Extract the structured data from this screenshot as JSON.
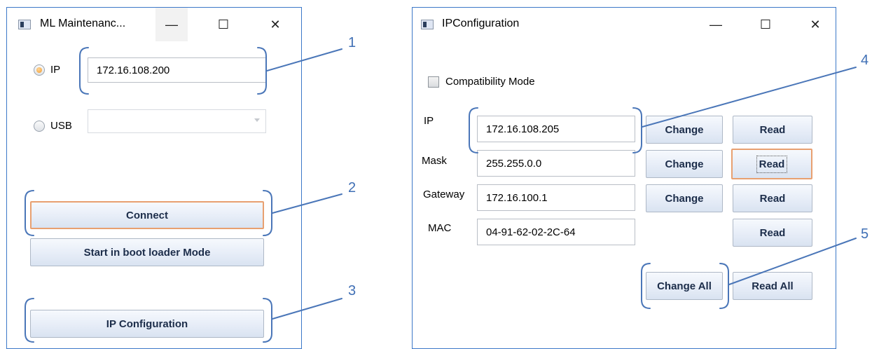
{
  "maintenance_window": {
    "title": "ML Maintenanc...",
    "caption_buttons": {
      "minimize": "—",
      "maximize": "☐",
      "close": "✕"
    },
    "ip_radio": {
      "label": "IP",
      "checked": true
    },
    "ip_value": "172.16.108.200",
    "usb_radio": {
      "label": "USB",
      "checked": false
    },
    "usb_combo_value": "",
    "connect_label": "Connect",
    "boot_loader_label": "Start in boot loader Mode",
    "ip_configuration_label": "IP Configuration"
  },
  "ipconfig_window": {
    "title": "IPConfiguration",
    "caption_buttons": {
      "minimize": "—",
      "maximize": "☐",
      "close": "✕"
    },
    "compatibility_mode": {
      "label": "Compatibility Mode",
      "checked": false
    },
    "rows": [
      {
        "label": "IP",
        "value": "172.16.108.205",
        "change_label": "Change",
        "read_label": "Read"
      },
      {
        "label": "Mask",
        "value": "255.255.0.0",
        "change_label": "Change",
        "read_label": "Read"
      },
      {
        "label": "Gateway",
        "value": "172.16.100.1",
        "change_label": "Change",
        "read_label": "Read"
      },
      {
        "label": "MAC",
        "value": "04-91-62-02-2C-64",
        "read_label": "Read"
      }
    ],
    "change_all_label": "Change All",
    "read_all_label": "Read All"
  },
  "callouts": [
    "1",
    "2",
    "3",
    "4",
    "5"
  ],
  "colors": {
    "annotation": "#4a76b8",
    "window_border": "#3c78c8",
    "focus_border": "#e8a070"
  }
}
